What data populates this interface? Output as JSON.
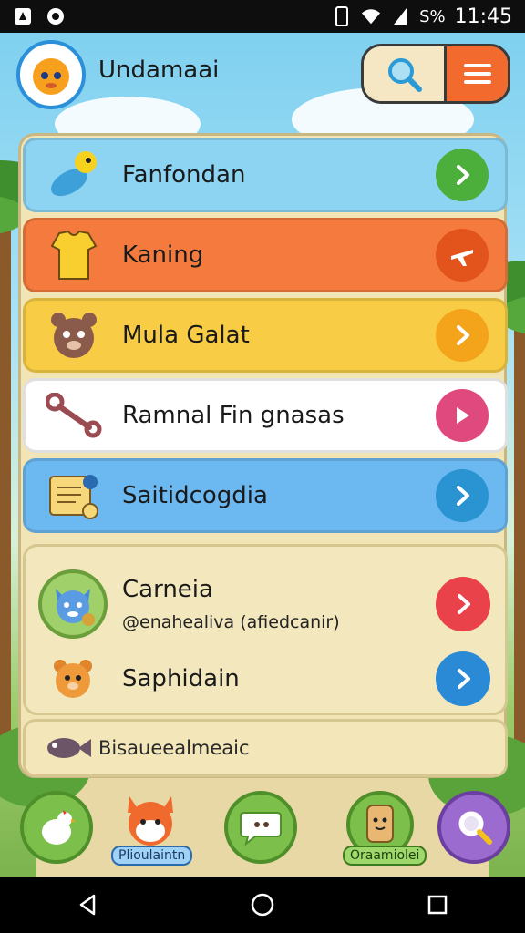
{
  "status_bar": {
    "time": "11:45",
    "battery_text": "S%"
  },
  "header": {
    "title": "Undamaai"
  },
  "menu_items": [
    {
      "label": "Fanfondan",
      "bg": "#8dd3f2",
      "button_color": "#4cae3b"
    },
    {
      "label": "Kaning",
      "bg": "#f47b3d",
      "button_color": "#e3541d"
    },
    {
      "label": "Mula Galat",
      "bg": "#f8cd45",
      "button_color": "#f4a41a"
    },
    {
      "label": "Ramnal Fin gnasas",
      "bg": "#ffffff",
      "button_color": "#e0497d"
    },
    {
      "label": "Saitidcogdia",
      "bg": "#6cb8f0",
      "button_color": "#2a94d2"
    }
  ],
  "group": {
    "first": {
      "title": "Carneia",
      "subtitle": "@enahealiva (afiedcanir)",
      "button_color": "#e9424a"
    },
    "second": {
      "title": "Saphidain",
      "button_color": "#2b8ad6"
    }
  },
  "footer_row": {
    "label": "Bisaueealmeaic"
  },
  "dock": {
    "item2_badge": "Plioulaintn",
    "item4_badge": "Oraamiolei"
  }
}
